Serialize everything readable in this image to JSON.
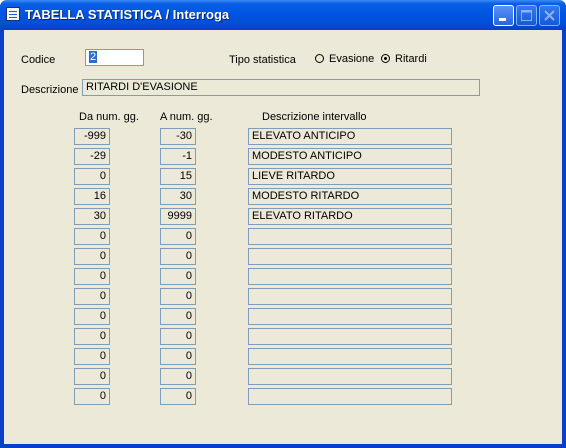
{
  "window": {
    "title": "TABELLA STATISTICA / Interroga"
  },
  "form": {
    "codice_label": "Codice",
    "codice_value": "2",
    "tipo_label": "Tipo statistica",
    "tipo_options": [
      "Evasione",
      "Ritardi"
    ],
    "tipo_selected": "Ritardi",
    "descrizione_label": "Descrizione",
    "descrizione_value": "RITARDI D'EVASIONE"
  },
  "table": {
    "headers": [
      "Da num. gg.",
      "A num. gg.",
      "Descrizione intervallo"
    ],
    "rows": [
      [
        "-999",
        "-30",
        "ELEVATO ANTICIPO"
      ],
      [
        "-29",
        "-1",
        "MODESTO ANTICIPO"
      ],
      [
        "0",
        "15",
        "LIEVE RITARDO"
      ],
      [
        "16",
        "30",
        "MODESTO RITARDO"
      ],
      [
        "30",
        "9999",
        "ELEVATO RITARDO"
      ],
      [
        "0",
        "0",
        ""
      ],
      [
        "0",
        "0",
        ""
      ],
      [
        "0",
        "0",
        ""
      ],
      [
        "0",
        "0",
        ""
      ],
      [
        "0",
        "0",
        ""
      ],
      [
        "0",
        "0",
        ""
      ],
      [
        "0",
        "0",
        ""
      ],
      [
        "0",
        "0",
        ""
      ],
      [
        "0",
        "0",
        ""
      ]
    ]
  }
}
